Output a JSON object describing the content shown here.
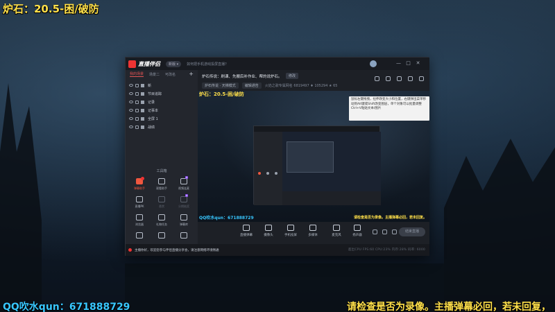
{
  "overlay": {
    "top_left_title": "炉石：20.5-困/破防",
    "bottom_left_qq": "QQ吹水qun：671888729",
    "bottom_right_warning": "请检查是否为录像。主播弹幕必回，若未回复，"
  },
  "app": {
    "name": "直播伴侣",
    "version_pill": "新版 ▾",
    "notice": "如何把手机游戏投屏直播？",
    "window_controls": [
      "—",
      "□",
      "✕"
    ]
  },
  "sidebar": {
    "scene_tabs": [
      "我的场景",
      "场景二",
      "可改名"
    ],
    "add_label": "+",
    "sources": [
      {
        "name": "新"
      },
      {
        "name": "节目追踪"
      },
      {
        "name": "记录"
      },
      {
        "name": "记事本"
      },
      {
        "name": "全屏 1"
      },
      {
        "name": "战绩"
      }
    ],
    "tools_title": "工具箱",
    "tools": [
      {
        "label": "弹幕助手",
        "style": "hot",
        "badge": true,
        "icon": "danmu-icon"
      },
      {
        "label": "观看助手",
        "style": "normal",
        "icon": "viewer-icon"
      },
      {
        "label": "视频连麦",
        "style": "normal",
        "new": true,
        "icon": "video-link-icon"
      },
      {
        "label": "直播PK",
        "style": "normal",
        "icon": "pk-icon"
      },
      {
        "label": "悬赏",
        "style": "dim",
        "icon": "reward-icon"
      },
      {
        "label": "分期抽奖",
        "style": "dim",
        "new": true,
        "icon": "lottery-icon"
      },
      {
        "label": "浏览器",
        "style": "normal",
        "icon": "browser-icon"
      },
      {
        "label": "礼物任务",
        "style": "normal",
        "icon": "gift-task-icon"
      },
      {
        "label": "弹幕库",
        "style": "normal",
        "icon": "danmu-lib-icon"
      },
      {
        "label": "",
        "style": "normal",
        "icon": "record-icon"
      },
      {
        "label": "",
        "style": "normal",
        "icon": "download-icon"
      },
      {
        "label": "",
        "style": "normal",
        "icon": "share-icon"
      }
    ]
  },
  "room": {
    "title": "炉石传说：刷课、先搬后补作业、帮的说炉石。",
    "edit_label": "修改",
    "category": "炉石传说 · 天梯模式",
    "notice_label": "编辑通告",
    "stats": "火焰之歌专属网名  6819497  ♦ 105294  ★ 65"
  },
  "preview": {
    "overlay_title": "炉石：20.5-困/破防",
    "qq": "QQ吹水qun：671888729",
    "warning": "请检查是否为录像。主播弹幕必回，若未回复。",
    "tooltip": "鼠标左键拖拽，拉伸改变大小和位置，右键弹出菜单移动到Alt键或Shift改变图层，单个对象可以批量调整 Ctrl+V粘贴文本/图片"
  },
  "controls": {
    "buttons": [
      {
        "label": "直播弹幕",
        "icon": "live-danmu-icon"
      },
      {
        "label": "摄像头",
        "icon": "camera-icon"
      },
      {
        "label": "手机投屏",
        "icon": "phone-cast-icon"
      },
      {
        "label": "多媒体",
        "icon": "media-icon"
      },
      {
        "label": "麦克风",
        "icon": "mic-icon"
      },
      {
        "label": "扬声器",
        "icon": "speaker-icon"
      }
    ],
    "go_live": "结束直播"
  },
  "status": {
    "message": "主播你好，欢迎您参与伴侣直播分享会，请注意网络环境畅通",
    "stats": "超出CPU  FPS:60  CPU:23%  内存:28%  码率: 6000"
  }
}
